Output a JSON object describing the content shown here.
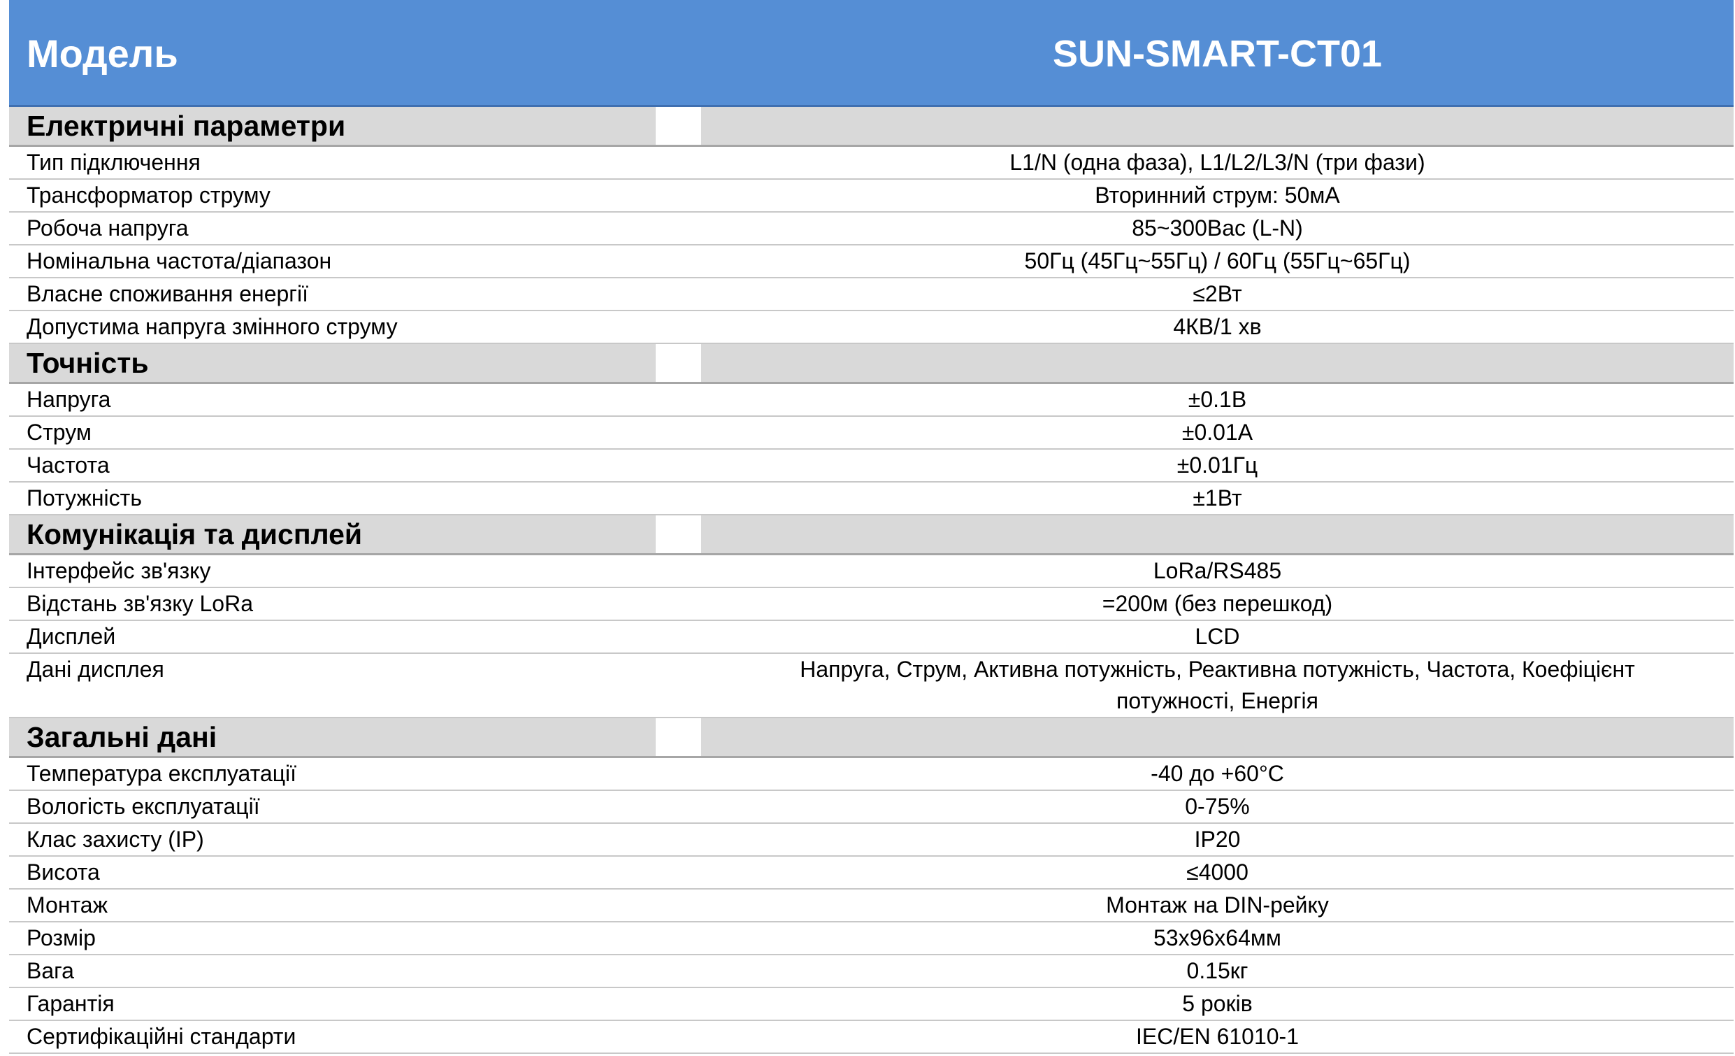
{
  "header": {
    "left": "Модель",
    "right": "SUN-SMART-CT01"
  },
  "sections": [
    {
      "title": "Електричні параметри",
      "rows": [
        {
          "label": "Тип підключення",
          "value": "L1/N (одна фаза), L1/L2/L3/N (три фази)"
        },
        {
          "label": "Трансформатор струму",
          "value": "Вторинний струм: 50мА"
        },
        {
          "label": "Робоча напруга",
          "value": "85~300Вас (L-N)"
        },
        {
          "label": "Номінальна частота/діапазон",
          "value": "50Гц (45Гц~55Гц) / 60Гц (55Гц~65Гц)"
        },
        {
          "label": "Власне споживання енергії",
          "value": "≤2Вт"
        },
        {
          "label": "Допустима напруга змінного струму",
          "value": "4КВ/1 хв"
        }
      ]
    },
    {
      "title": "Точність",
      "rows": [
        {
          "label": "Напруга",
          "value": "±0.1В"
        },
        {
          "label": "Струм",
          "value": "±0.01А"
        },
        {
          "label": "Частота",
          "value": "±0.01Гц"
        },
        {
          "label": "Потужність",
          "value": "±1Вт"
        }
      ]
    },
    {
      "title": "Комунікація та дисплей",
      "rows": [
        {
          "label": "Інтерфейс зв'язку",
          "value": "LoRa/RS485"
        },
        {
          "label": "Відстань зв'язку LoRa",
          "value": "=200м (без перешкод)"
        },
        {
          "label": "Дисплей",
          "value": "LCD"
        },
        {
          "label": "Дані дисплея",
          "value": "Напруга, Струм, Активна потужність, Реактивна потужність, Частота, Коефіцієнт потужності, Енергія"
        }
      ]
    },
    {
      "title": "Загальні дані",
      "rows": [
        {
          "label": "Температура експлуатації",
          "value": "-40 до +60°C"
        },
        {
          "label": "Вологість експлуатації",
          "value": "0-75%"
        },
        {
          "label": "Клас захисту (IP)",
          "value": "IP20"
        },
        {
          "label": "Висота",
          "value": "≤4000"
        },
        {
          "label": "Монтаж",
          "value": "Монтаж на DIN-рейку"
        },
        {
          "label": "Розмір",
          "value": "53x96x64мм"
        },
        {
          "label": "Вага",
          "value": "0.15кг"
        },
        {
          "label": "Гарантія",
          "value": "5 років"
        },
        {
          "label": "Сертифікаційні стандарти",
          "value": "IEC/EN 61010-1"
        }
      ]
    }
  ]
}
